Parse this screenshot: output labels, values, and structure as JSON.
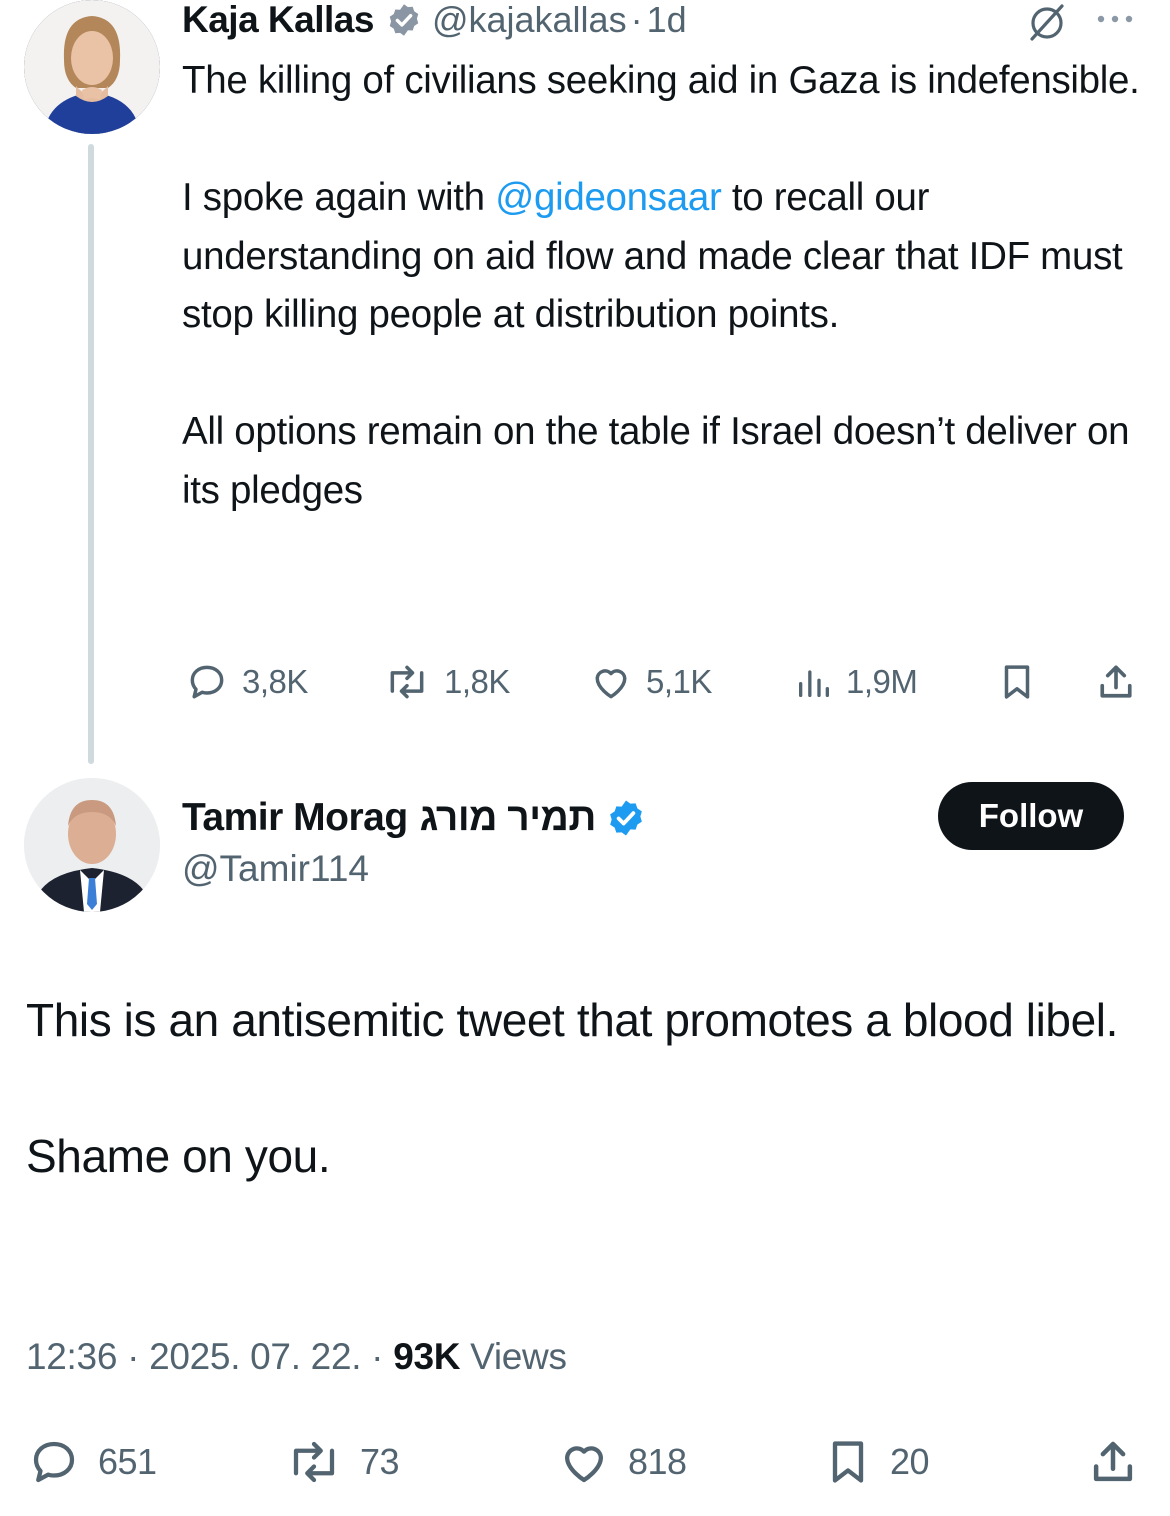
{
  "parent_tweet": {
    "author_name": "Kaja Kallas",
    "handle": "@kajakallas",
    "separator": "·",
    "time": "1d",
    "text": {
      "line1": "The killing of civilians seeking aid in Gaza is indefensible.",
      "para2_before": "I spoke again with ",
      "para2_mention": "@gideonsaar",
      "para2_after": " to recall our understanding on aid flow and made clear that IDF must stop killing people at distribution points.",
      "para3": "All options remain on the table if Israel doesn’t deliver on its pledges"
    },
    "actions": {
      "replies": "3,8K",
      "reposts": "1,8K",
      "likes": "5,1K",
      "views": "1,9M"
    }
  },
  "reply_tweet": {
    "author_name": "Tamir Morag",
    "author_name_hebrew": "תמיר מורג",
    "handle": "@Tamir114",
    "follow_label": "Follow",
    "text": {
      "para1": "This is an antisemitic tweet that promotes a blood libel.",
      "para2": "Shame on you."
    },
    "meta": {
      "time": "12:36",
      "sep1": " · ",
      "date": "2025. 07. 22.",
      "sep2": " · ",
      "views_count": "93K",
      "views_label": " Views"
    },
    "actions": {
      "replies": "651",
      "reposts": "73",
      "likes": "818",
      "bookmarks": "20"
    }
  },
  "colors": {
    "accent": "#1d9bf0",
    "text": "#0f1419",
    "secondary": "#536471",
    "verified_gold": "#8a96a3"
  },
  "icons": [
    "verified-badge-icon",
    "grok-icon",
    "more-icon",
    "reply-icon",
    "repost-icon",
    "like-icon",
    "views-icon",
    "bookmark-icon",
    "share-icon"
  ]
}
